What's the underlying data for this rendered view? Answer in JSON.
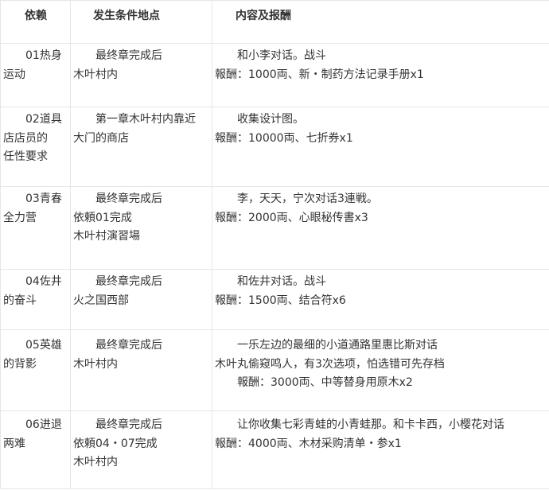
{
  "headers": {
    "name": "依赖",
    "condition": "发生条件地点",
    "content": "内容及报酬"
  },
  "rows": [
    {
      "name": [
        "01热身",
        "运动"
      ],
      "condition": [
        "最终章完成后",
        "木叶村内"
      ],
      "content": [
        "和小李对话。战斗",
        "報酬：1000両、新・制药方法记录手册x1"
      ]
    },
    {
      "name": [
        "02道具",
        "店店员的",
        "任性要求"
      ],
      "condition": [
        "第一章木叶村内靠近",
        "大门的商店"
      ],
      "content": [
        "收集设计图。",
        "報酬：10000両、七折券x1"
      ]
    },
    {
      "name": [
        "03青春",
        "全力营"
      ],
      "condition": [
        "最终章完成后",
        "依頼01完成",
        "木叶村演習場"
      ],
      "content": [
        "李，天天，宁次对话3連戦。",
        "報酬：2000両、心眼秘传書x3"
      ]
    },
    {
      "name": [
        "04佐井",
        "的奋斗"
      ],
      "condition": [
        "最终章完成后",
        "火之国西部"
      ],
      "content": [
        "和佐井对话。战斗",
        "報酬：1500両、结合符x6"
      ]
    },
    {
      "name": [
        "05英雄",
        "的背影"
      ],
      "condition": [
        "最终章完成后",
        "木叶村内"
      ],
      "content": [
        "一乐左边的最细的小道通路里惠比斯对话",
        "木叶丸偷窥鸣人，有3次选项，怕选错可先存档",
        "報酬：3000両、中等替身用原木x2"
      ]
    },
    {
      "name": [
        "06进退",
        "两难"
      ],
      "condition": [
        "最终章完成后",
        "依頼04・07完成",
        "木叶村内"
      ],
      "content": [
        "让你收集七彩青蛙的小青蛙那。和卡卡西，小樱花对话",
        "報酬：4000両、木材采购清单・参x1"
      ]
    }
  ]
}
